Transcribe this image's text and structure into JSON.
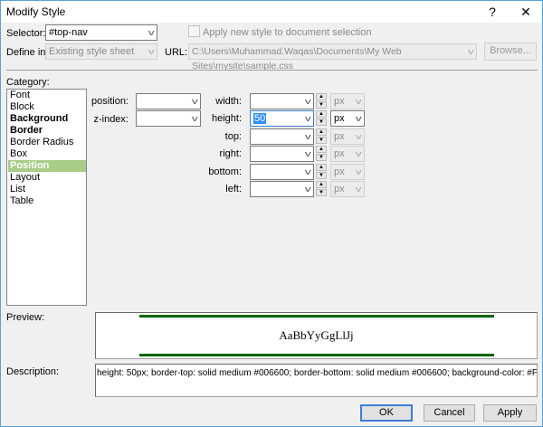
{
  "window": {
    "title": "Modify Style",
    "help_label": "?",
    "close_label": "✕"
  },
  "top": {
    "selector_label": "Selector:",
    "selector_value": "#top-nav",
    "apply_checkbox_label": "Apply new style to document selection",
    "apply_checked": false,
    "define_in_label": "Define in:",
    "define_in_value": "Existing style sheet",
    "url_label": "URL:",
    "url_value": "C:\\Users\\Muhammad.Waqas\\Documents\\My Web Sites\\mysite\\sample.css",
    "browse_label": "Browse..."
  },
  "category": {
    "label": "Category:",
    "items": [
      {
        "label": "Font",
        "bold": false
      },
      {
        "label": "Block",
        "bold": false
      },
      {
        "label": "Background",
        "bold": true
      },
      {
        "label": "Border",
        "bold": true
      },
      {
        "label": "Border Radius",
        "bold": false
      },
      {
        "label": "Box",
        "bold": false
      },
      {
        "label": "Position",
        "bold": true,
        "selected": true
      },
      {
        "label": "Layout",
        "bold": false
      },
      {
        "label": "List",
        "bold": false
      },
      {
        "label": "Table",
        "bold": false
      }
    ],
    "selected_color": "#A9CD88"
  },
  "position": {
    "position_label": "position:",
    "position_value": "",
    "zindex_label": "z-index:",
    "zindex_value": "",
    "fields": [
      {
        "label": "width:",
        "value": "",
        "unit": "px",
        "unit_enabled": false
      },
      {
        "label": "height:",
        "value": "50",
        "unit": "px",
        "unit_enabled": true
      },
      {
        "label": "top:",
        "value": "",
        "unit": "px",
        "unit_enabled": false
      },
      {
        "label": "right:",
        "value": "",
        "unit": "px",
        "unit_enabled": false
      },
      {
        "label": "bottom:",
        "value": "",
        "unit": "px",
        "unit_enabled": false
      },
      {
        "label": "left:",
        "value": "",
        "unit": "px",
        "unit_enabled": false
      }
    ]
  },
  "preview": {
    "label": "Preview:",
    "sample_text": "AaBbYyGgLlJj",
    "border_color": "#006600"
  },
  "description": {
    "label": "Description:",
    "text": "height: 50px; border-top: solid medium #006600; border-bottom: solid medium #006600; background-color: #FFFFFF"
  },
  "buttons": {
    "ok": "OK",
    "cancel": "Cancel",
    "apply": "Apply"
  }
}
